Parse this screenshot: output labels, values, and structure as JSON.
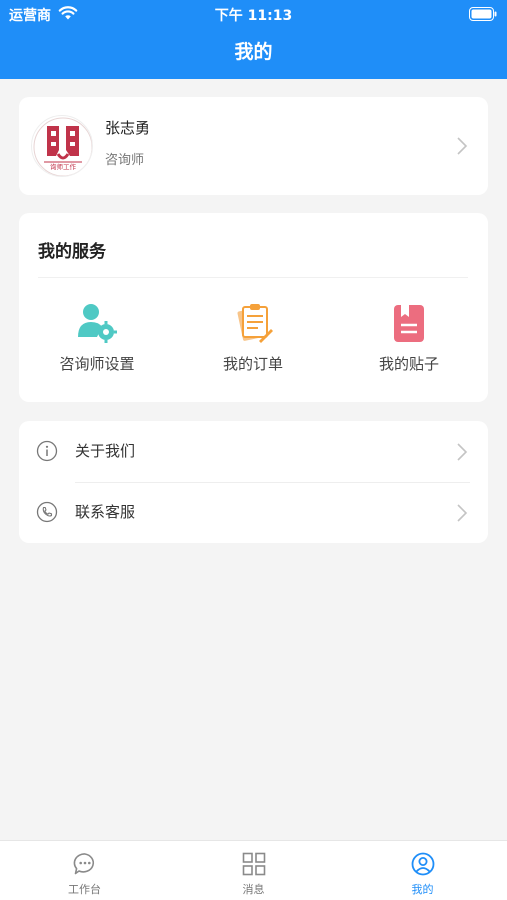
{
  "status_bar": {
    "carrier": "运营商",
    "time": "下午 11:13"
  },
  "header": {
    "title": "我的"
  },
  "profile": {
    "name": "张志勇",
    "role": "咨询师",
    "avatar_caption": "询师工作"
  },
  "services": {
    "title": "我的服务",
    "items": [
      {
        "label": "咨询师设置",
        "icon": "counselor-settings-icon"
      },
      {
        "label": "我的订单",
        "icon": "orders-icon"
      },
      {
        "label": "我的贴子",
        "icon": "posts-icon"
      }
    ]
  },
  "menu": {
    "items": [
      {
        "label": "关于我们",
        "icon": "info-icon"
      },
      {
        "label": "联系客服",
        "icon": "phone-icon"
      }
    ]
  },
  "tabbar": {
    "items": [
      {
        "label": "工作台",
        "icon": "chat-bubble-icon",
        "active": false
      },
      {
        "label": "消息",
        "icon": "grid-icon",
        "active": false
      },
      {
        "label": "我的",
        "icon": "user-icon",
        "active": true
      }
    ]
  },
  "colors": {
    "primary": "#1f8ef8",
    "background": "#f4f4f4",
    "teal": "#4fc9c4",
    "orange": "#f5a13a",
    "pink": "#ec6d7f"
  }
}
